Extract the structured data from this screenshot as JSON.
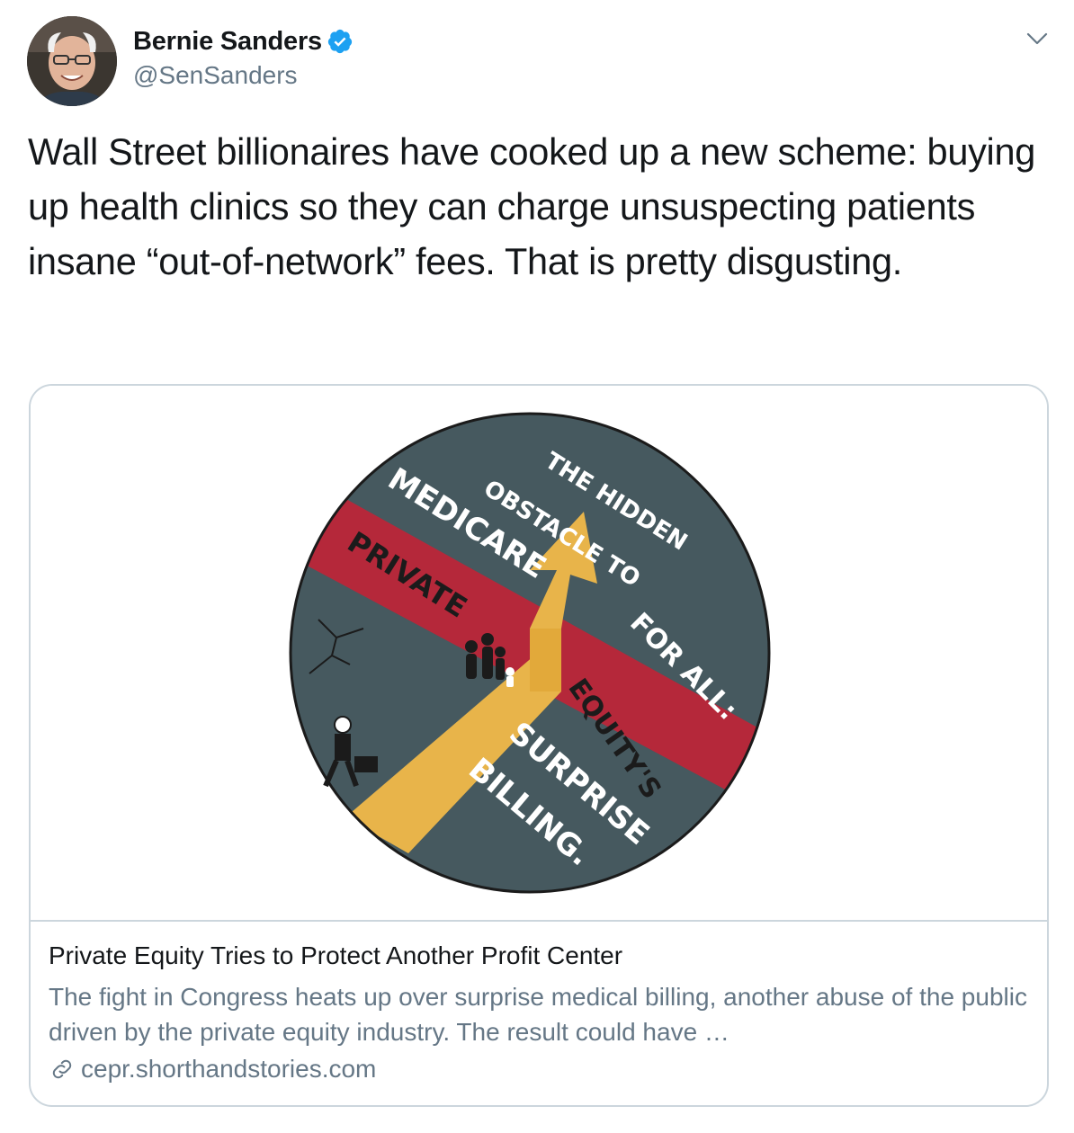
{
  "author": {
    "display_name": "Bernie Sanders",
    "handle": "@SenSanders",
    "verified": true
  },
  "tweet": {
    "text": "Wall Street billionaires have cooked up a new scheme: buying up health clinics so they can charge unsuspecting patients insane “out-of-network” fees. That is pretty disgusting."
  },
  "card": {
    "illustration_text": {
      "line1": "THE HIDDEN",
      "line2": "OBSTACLE TO",
      "line3": "MEDICARE",
      "line4": "FOR ALL:",
      "line5": "PRIVATE",
      "line6": "EQUITY'S",
      "line7": "SURPRISE",
      "line8": "BILLING."
    },
    "title": "Private Equity Tries to Protect Another Profit Center",
    "description": "The fight in Congress heats up over surprise medical billing, another abuse of the public driven by the private equity industry. The result could have …",
    "domain": "cepr.shorthandstories.com"
  },
  "icons": {
    "verified": "verified-badge-icon",
    "menu": "chevron-down-icon",
    "link": "link-icon"
  },
  "colors": {
    "verified_blue": "#1da1f2",
    "secondary_text": "#657786",
    "card_border": "#ccd6dd",
    "circle_fill": "#46595f",
    "band_red": "#b5283a",
    "path_yellow": "#e8b44a"
  }
}
